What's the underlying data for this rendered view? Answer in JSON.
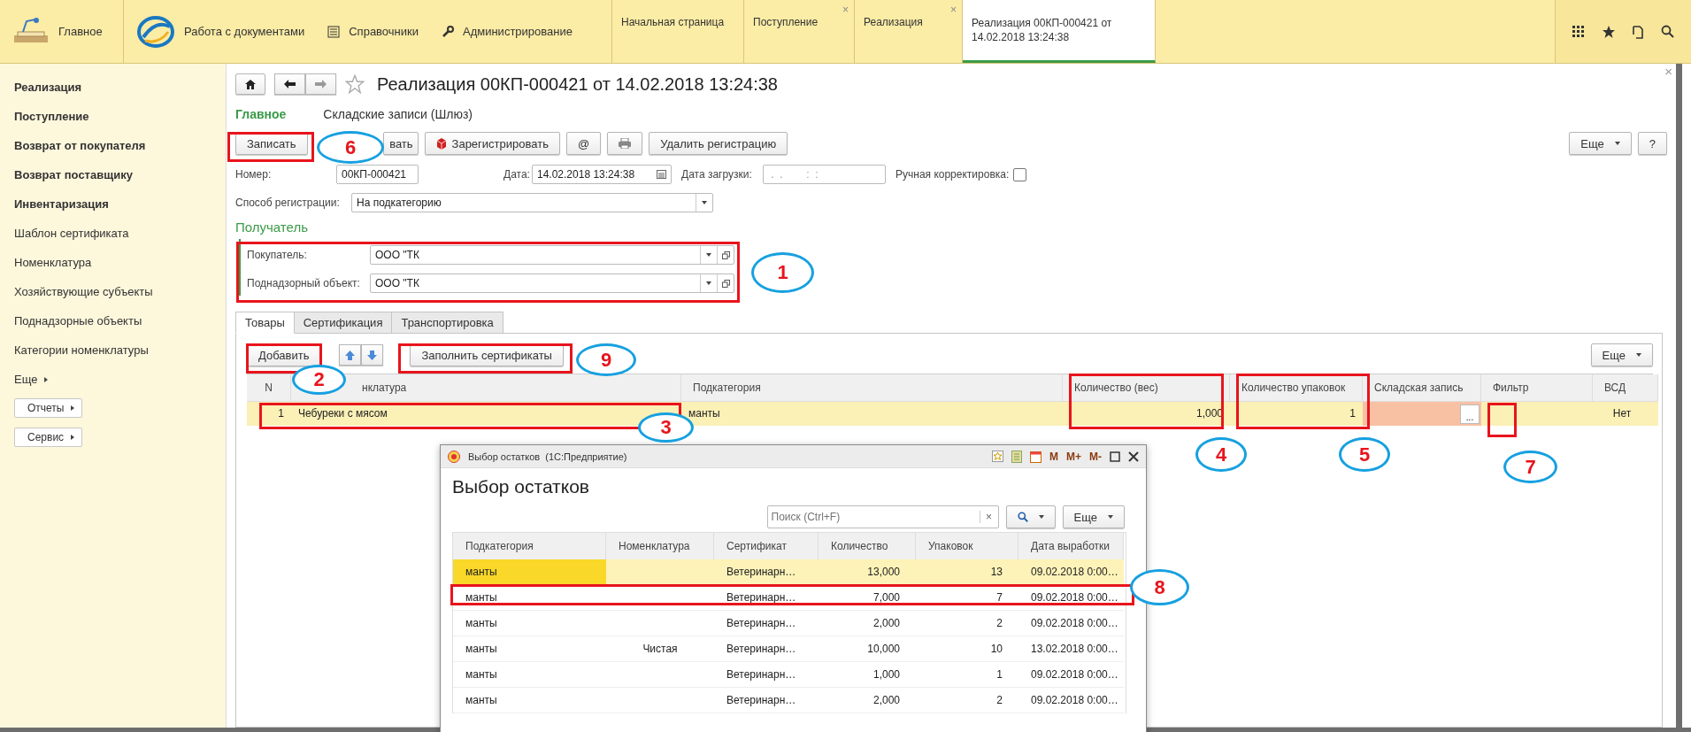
{
  "topbar": {
    "sections": [
      {
        "label": "Главное"
      },
      {
        "label": "Работа с документами"
      },
      {
        "label": "Справочники"
      },
      {
        "label": "Администрирование"
      }
    ],
    "tabs": [
      {
        "label": "Начальная страница",
        "selected": false
      },
      {
        "label": "Поступление",
        "selected": false,
        "close": "×"
      },
      {
        "label": "Реализация",
        "selected": false,
        "close": "×"
      },
      {
        "label": "Реализация 00КП-000421 от 14.02.2018 13:24:38",
        "selected": true
      }
    ]
  },
  "sidebar": {
    "items": [
      {
        "label": "Реализация",
        "bold": true
      },
      {
        "label": "Поступление",
        "bold": true
      },
      {
        "label": "Возврат от покупателя",
        "bold": true
      },
      {
        "label": "Возврат поставщику",
        "bold": true
      },
      {
        "label": "Инвентаризация",
        "bold": true
      },
      {
        "label": "Шаблон сертификата",
        "bold": false
      },
      {
        "label": "Номенклатура",
        "bold": false
      },
      {
        "label": "Хозяйствующие субъекты",
        "bold": false
      },
      {
        "label": "Поднадзорные объекты",
        "bold": false
      },
      {
        "label": "Категории номенклатуры",
        "bold": false
      }
    ],
    "more": "Еще",
    "buttons": [
      "Отчеты",
      "Сервис"
    ]
  },
  "form": {
    "title": "Реализация 00КП-000421 от 14.02.2018 13:24:38",
    "close": "×",
    "sections": [
      {
        "label": "Главное",
        "selected": true
      },
      {
        "label": "Складские записи (Шлюз)",
        "selected": false
      }
    ],
    "commands": [
      {
        "kind": "text",
        "label": "Записать"
      },
      {
        "kind": "text",
        "label": "вать"
      },
      {
        "kind": "register",
        "label": "Зарегистрировать"
      },
      {
        "kind": "text",
        "label": "@"
      },
      {
        "kind": "print"
      },
      {
        "kind": "text",
        "label": "Удалить регистрацию"
      }
    ],
    "more": "Еще",
    "help": "?",
    "number": {
      "label": "Номер:",
      "value": "00КП-000421"
    },
    "date": {
      "label": "Дата:",
      "value": "14.02.2018 13:24:38"
    },
    "load_date": {
      "label": "Дата загрузки:",
      "placeholder": " .  .        :  :"
    },
    "manual": {
      "label": "Ручная корректировка:",
      "checked": false
    },
    "method": {
      "label": "Способ регистрации:",
      "value": "На подкатегорию"
    },
    "recipient": {
      "title": "Получатель",
      "fields": [
        {
          "label": "Покупатель:",
          "value": "ООО \"ТК"
        },
        {
          "label": "Поднадзорный объект:",
          "value": "ООО \"ТК"
        }
      ]
    },
    "tabs": [
      {
        "label": "Товары",
        "selected": true
      },
      {
        "label": "Сертификация",
        "selected": false
      },
      {
        "label": "Транспортировка",
        "selected": false
      }
    ],
    "goods": {
      "add": "Добавить",
      "fill": "Заполнить сертификаты",
      "more": "Еще",
      "columns": [
        "N",
        "нклатура",
        "Подкатегория",
        "Количество (вес)",
        "Количество упаковок",
        "Складская запись",
        "Фильтр",
        "ВСД"
      ],
      "rows": [
        {
          "n": "1",
          "nomenclature": "Чебуреки с мясом",
          "subcategory": "манты",
          "weight": "1,000",
          "packs": "1",
          "storage_missing": true,
          "picker": "...",
          "vsd": "Нет",
          "selected": true
        }
      ]
    }
  },
  "dialog": {
    "title": "Выбор остатков  (1С:Предприятие)",
    "memory": [
      "M",
      "M+",
      "M-"
    ],
    "heading": "Выбор остатков",
    "search": {
      "placeholder": "Поиск (Ctrl+F)",
      "clear": "×"
    },
    "more": "Еще",
    "columns": [
      "Подкатегория",
      "Номенклатура",
      "Сертификат",
      "Количество",
      "Упаковок",
      "Дата выработки"
    ],
    "rows": [
      {
        "subcategory": "манты",
        "certificate": "Ветеринарн…",
        "quantity": "13,000",
        "packs": "13",
        "date": "09.02.2018 0:00…",
        "selected": true
      },
      {
        "subcategory": "манты",
        "certificate": "Ветеринарн…",
        "quantity": "7,000",
        "packs": "7",
        "date": "09.02.2018 0:00…",
        "selected": false
      },
      {
        "subcategory": "манты",
        "certificate": "Ветеринарн…",
        "quantity": "2,000",
        "packs": "2",
        "date": "09.02.2018 0:00…",
        "selected": false
      },
      {
        "subcategory": "манты",
        "nomenclature": "Чистая",
        "certificate": "Ветеринарн…",
        "quantity": "10,000",
        "packs": "10",
        "date": "13.02.2018 0:00…",
        "selected": false
      },
      {
        "subcategory": "манты",
        "certificate": "Ветеринарн…",
        "quantity": "1,000",
        "packs": "1",
        "date": "09.02.2018 0:00…",
        "selected": false
      },
      {
        "subcategory": "манты",
        "certificate": "Ветеринарн…",
        "quantity": "2,000",
        "packs": "2",
        "date": "09.02.2018 0:00…",
        "selected": false
      }
    ]
  },
  "annotations": [
    {
      "number": "6"
    },
    {
      "number": "1"
    },
    {
      "number": "2"
    },
    {
      "number": "9"
    },
    {
      "number": "3"
    },
    {
      "number": "4"
    },
    {
      "number": "5"
    },
    {
      "number": "7"
    },
    {
      "number": "8"
    }
  ]
}
